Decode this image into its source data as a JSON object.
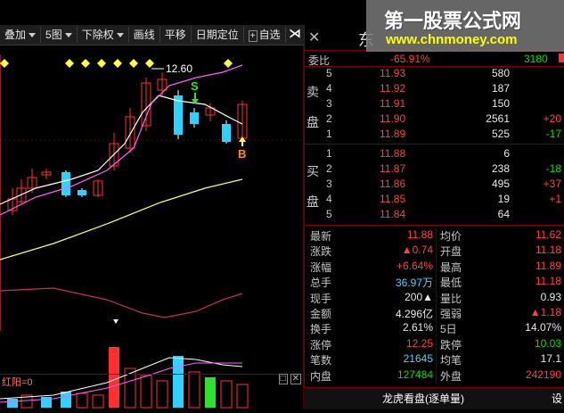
{
  "toolbar": {
    "items": [
      "叠加",
      "5图",
      "下除权",
      "画线",
      "平移",
      "日期定位",
      "自选"
    ],
    "close_icon": "close-arrow-icon"
  },
  "chart": {
    "max_price_label": "12.60",
    "s_label": "S",
    "b_label": "B",
    "sub_label": "红阳=0",
    "colors": {
      "up": "#ff3030",
      "down": "#30d0ff",
      "ma5": "#ffffff",
      "ma10": "#ff60ff",
      "ma20": "#ffff60"
    }
  },
  "banner": {
    "title": "第一股票公式网",
    "url": "www.chnmoney.com"
  },
  "quote": {
    "name": "东",
    "weibi_label": "委比",
    "weibi_value": "-65.91%",
    "weibi_diff": "3180",
    "sell_side": "卖盘",
    "buy_side": "买盘",
    "sells": [
      {
        "level": "5",
        "price": "11.93",
        "vol": "580",
        "chg": ""
      },
      {
        "level": "4",
        "price": "11.92",
        "vol": "187",
        "chg": ""
      },
      {
        "level": "3",
        "price": "11.91",
        "vol": "150",
        "chg": ""
      },
      {
        "level": "2",
        "price": "11.90",
        "vol": "2561",
        "chg": "+20"
      },
      {
        "level": "1",
        "price": "11.89",
        "vol": "525",
        "chg": "-17"
      }
    ],
    "buys": [
      {
        "level": "1",
        "price": "11.88",
        "vol": "6",
        "chg": ""
      },
      {
        "level": "2",
        "price": "11.87",
        "vol": "238",
        "chg": "-18"
      },
      {
        "level": "3",
        "price": "11.86",
        "vol": "495",
        "chg": "+37"
      },
      {
        "level": "4",
        "price": "11.85",
        "vol": "19",
        "chg": "+1"
      },
      {
        "level": "5",
        "price": "11.84",
        "vol": "64",
        "chg": ""
      }
    ],
    "stats": [
      {
        "l1": "最新",
        "v1": "11.88",
        "c1": "red",
        "l2": "均价",
        "v2": "11.62",
        "c2": "red"
      },
      {
        "l1": "涨跌",
        "v1": "▲0.74",
        "c1": "red",
        "l2": "开盘",
        "v2": "11.18",
        "c2": "red"
      },
      {
        "l1": "涨幅",
        "v1": "+6.64%",
        "c1": "red",
        "l2": "最高",
        "v2": "11.89",
        "c2": "red"
      },
      {
        "l1": "总手",
        "v1": "36.97万",
        "c1": "cyan",
        "l2": "最低",
        "v2": "11.18",
        "c2": "red"
      },
      {
        "l1": "现手",
        "v1": "200▲",
        "c1": "wht",
        "l2": "量比",
        "v2": "0.93",
        "c2": "wht"
      },
      {
        "l1": "金额",
        "v1": "4.296亿",
        "c1": "wht",
        "l2": "强弱",
        "v2": "▲1.18",
        "c2": "red"
      },
      {
        "l1": "换手",
        "v1": "2.61%",
        "c1": "wht",
        "l2": "5日",
        "v2": "14.07%",
        "c2": "wht"
      },
      {
        "l1": "涨停",
        "v1": "12.25",
        "c1": "red",
        "l2": "跌停",
        "v2": "10.03",
        "c2": "grn"
      },
      {
        "l1": "笔数",
        "v1": "21645",
        "c1": "cyan",
        "l2": "均笔",
        "v2": "17.1",
        "c2": "wht"
      },
      {
        "l1": "内盘",
        "v1": "127484",
        "c1": "grn",
        "l2": "外盘",
        "v2": "242190",
        "c2": "red"
      }
    ]
  },
  "tabs": {
    "active": "龙虎看盘(逐单量)",
    "settings": "设"
  }
}
